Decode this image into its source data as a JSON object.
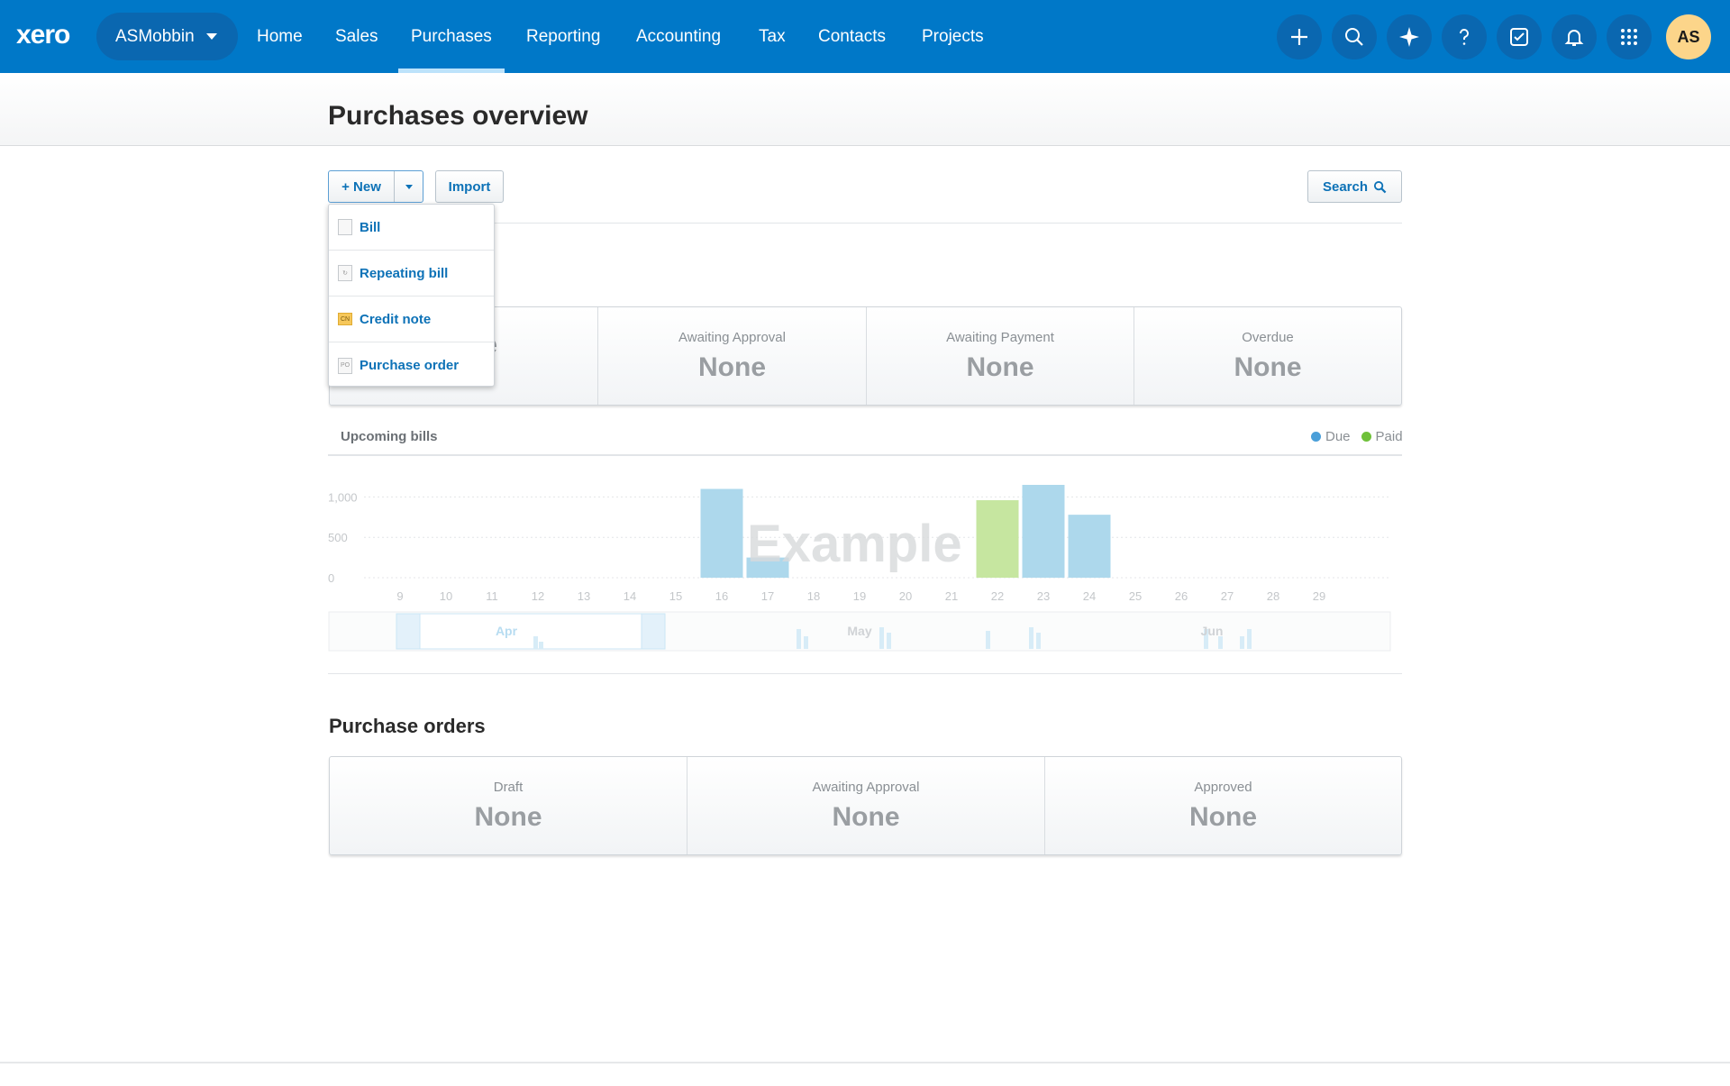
{
  "brand": {
    "logo": "xero",
    "org_name": "ASMobbin",
    "color": "#0078c8"
  },
  "nav": {
    "items": [
      {
        "label": "Home"
      },
      {
        "label": "Sales"
      },
      {
        "label": "Purchases",
        "active": true
      },
      {
        "label": "Reporting"
      },
      {
        "label": "Accounting"
      },
      {
        "label": "Tax"
      },
      {
        "label": "Contacts"
      },
      {
        "label": "Projects"
      }
    ],
    "icons": [
      "plus-icon",
      "search-icon",
      "sparkle-icon",
      "help-icon",
      "tasks-icon",
      "bell-icon",
      "apps-grid-icon"
    ],
    "avatar_initials": "AS"
  },
  "page": {
    "title": "Purchases overview"
  },
  "toolbar": {
    "new_label": "+ New",
    "import_label": "Import",
    "search_label": "Search"
  },
  "new_menu": {
    "items": [
      {
        "label": "Bill",
        "icon": "bill-icon"
      },
      {
        "label": "Repeating bill",
        "icon": "repeating-bill-icon"
      },
      {
        "label": "Credit note",
        "icon": "credit-note-icon",
        "icon_text": "CN"
      },
      {
        "label": "Purchase order",
        "icon": "purchase-order-icon",
        "icon_text": "PO"
      }
    ]
  },
  "bills_summary": {
    "cells": [
      {
        "label": "",
        "value": "None"
      },
      {
        "label": "Awaiting Approval",
        "value": "None"
      },
      {
        "label": "Awaiting Payment",
        "value": "None"
      },
      {
        "label": "Overdue",
        "value": "None"
      }
    ]
  },
  "upcoming_bills": {
    "title": "Upcoming bills",
    "legend": [
      {
        "label": "Due",
        "color": "#4a9fd9"
      },
      {
        "label": "Paid",
        "color": "#6fc13a"
      }
    ],
    "watermark": "Example",
    "range_months": [
      "Apr",
      "May",
      "Jun"
    ]
  },
  "chart_data": {
    "type": "bar",
    "title": "Upcoming bills",
    "categories": [
      "9",
      "10",
      "11",
      "12",
      "13",
      "14",
      "15",
      "16",
      "17",
      "18",
      "19",
      "20",
      "21",
      "22",
      "23",
      "24",
      "25",
      "26",
      "27",
      "28",
      "29"
    ],
    "series": [
      {
        "name": "Due",
        "color": "#add8ec",
        "values": [
          0,
          0,
          0,
          0,
          0,
          0,
          0,
          1100,
          250,
          0,
          0,
          0,
          0,
          0,
          1150,
          780,
          0,
          0,
          0,
          0,
          0
        ]
      },
      {
        "name": "Paid",
        "color": "#c6e6a0",
        "values": [
          0,
          0,
          0,
          0,
          0,
          0,
          0,
          0,
          0,
          0,
          0,
          0,
          0,
          960,
          0,
          0,
          0,
          0,
          0,
          0,
          0
        ]
      }
    ],
    "y_ticks": [
      "1,000",
      "500",
      "0"
    ],
    "ylim": [
      0,
      1150
    ],
    "grid": true,
    "legend_position": "top-right"
  },
  "purchase_orders": {
    "title": "Purchase orders",
    "cells": [
      {
        "label": "Draft",
        "value": "None"
      },
      {
        "label": "Awaiting Approval",
        "value": "None"
      },
      {
        "label": "Approved",
        "value": "None"
      }
    ]
  }
}
